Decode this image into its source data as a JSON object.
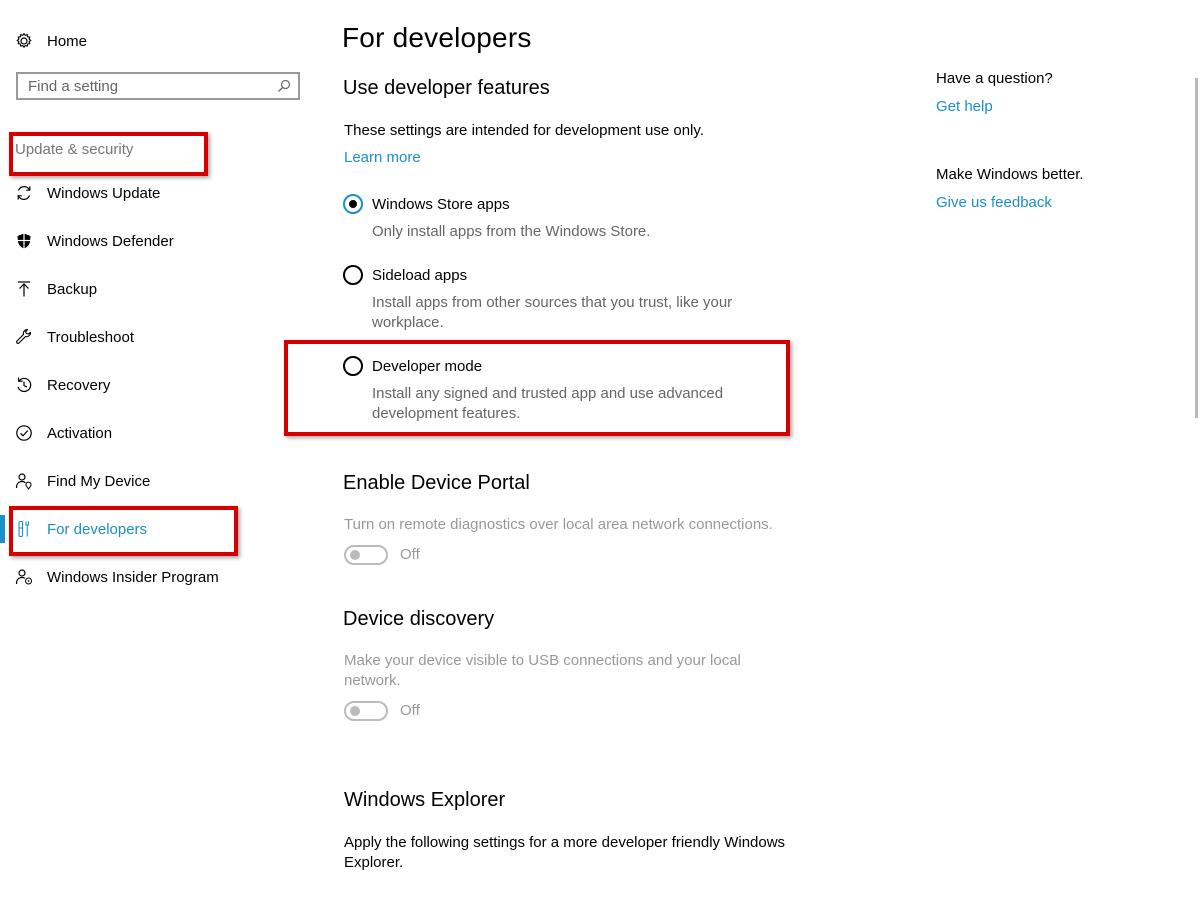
{
  "sidebar": {
    "home_label": "Home",
    "search": {
      "placeholder": "Find a setting"
    },
    "section_heading": "Update & security",
    "items": [
      {
        "label": "Windows Update",
        "icon": "sync-icon"
      },
      {
        "label": "Windows Defender",
        "icon": "shield-icon"
      },
      {
        "label": "Backup",
        "icon": "backup-arrow-icon"
      },
      {
        "label": "Troubleshoot",
        "icon": "wrench-icon"
      },
      {
        "label": "Recovery",
        "icon": "recovery-icon"
      },
      {
        "label": "Activation",
        "icon": "check-circle-icon"
      },
      {
        "label": "Find My Device",
        "icon": "person-location-icon"
      },
      {
        "label": "For developers",
        "icon": "developer-tools-icon",
        "active": true
      },
      {
        "label": "Windows Insider Program",
        "icon": "insider-person-icon"
      }
    ]
  },
  "main": {
    "title": "For developers",
    "dev_features": {
      "heading": "Use developer features",
      "intro": "These settings are intended for development use only.",
      "learn_more": "Learn more",
      "options": [
        {
          "label": "Windows Store apps",
          "description": "Only install apps from the Windows Store.",
          "selected": true
        },
        {
          "label": "Sideload apps",
          "description": "Install apps from other sources that you trust, like your workplace.",
          "selected": false
        },
        {
          "label": "Developer mode",
          "description": "Install any signed and trusted app and use advanced development features.",
          "selected": false
        }
      ]
    },
    "device_portal": {
      "heading": "Enable Device Portal",
      "description": "Turn on remote diagnostics over local area network connections.",
      "toggle_state": "Off"
    },
    "device_discovery": {
      "heading": "Device discovery",
      "description": "Make your device visible to USB connections and your local network.",
      "toggle_state": "Off"
    },
    "explorer": {
      "heading": "Windows Explorer",
      "description": "Apply the following settings for a more developer friendly Windows Explorer."
    }
  },
  "aside": {
    "question": "Have a question?",
    "get_help": "Get help",
    "feedback_prompt": "Make Windows better.",
    "feedback_link": "Give us feedback"
  },
  "colors": {
    "accent": "#1b8fc9",
    "annotation_red": "#d40000",
    "secondary_text": "#666666",
    "disabled_text": "#999999"
  }
}
